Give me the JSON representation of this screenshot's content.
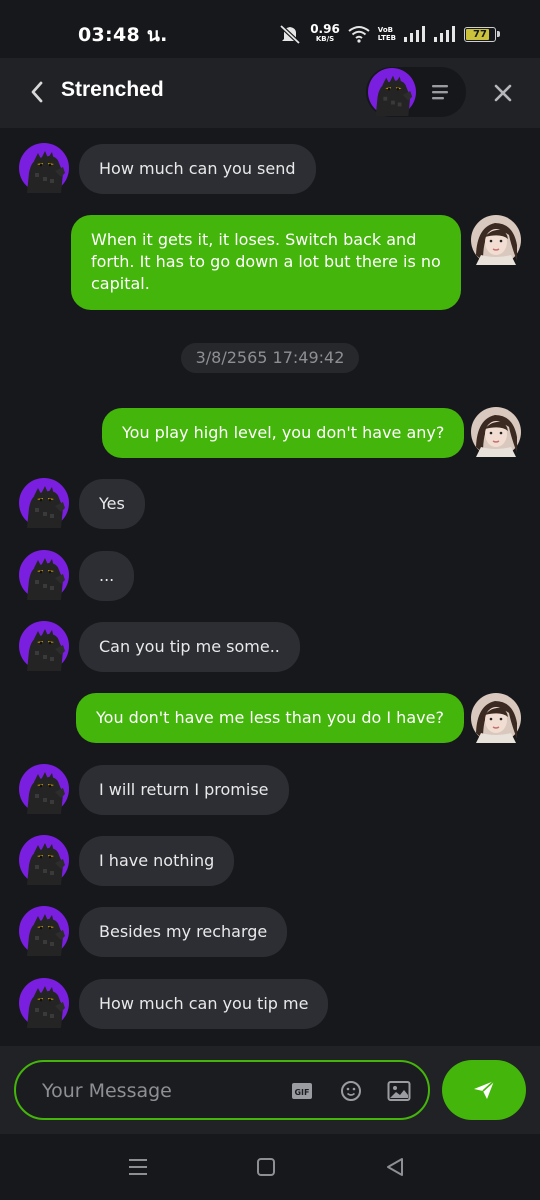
{
  "status_bar": {
    "time": "03:48 น.",
    "net_speed_value": "0.96",
    "net_speed_unit": "KB/S",
    "volte_top": "VoB",
    "volte_bottom": "LTEB",
    "battery": "77"
  },
  "header": {
    "title": "Strenched",
    "icons": [
      "back-arrow-icon",
      "avatar",
      "menu-icon",
      "close-icon"
    ]
  },
  "chat": {
    "timestamp": "3/8/2565 17:49:42",
    "messages": [
      {
        "side": "in",
        "text": "How much can you send"
      },
      {
        "side": "out",
        "text": "When it gets it, it loses. Switch back and forth. It has to go down a lot but there is no capital."
      },
      {
        "side": "out",
        "text": "You play high level, you don't have any?"
      },
      {
        "side": "in",
        "text": "Yes"
      },
      {
        "side": "in",
        "text": "..."
      },
      {
        "side": "in",
        "text": "Can you tip me some.."
      },
      {
        "side": "out",
        "text": "You don't have me less than you do I have?"
      },
      {
        "side": "in",
        "text": "I will return I promise"
      },
      {
        "side": "in",
        "text": "I have nothing"
      },
      {
        "side": "in",
        "text": "Besides my recharge"
      },
      {
        "side": "in",
        "text": "How much can you tip me"
      }
    ]
  },
  "composer": {
    "placeholder": "Your Message",
    "gif_label": "GIF"
  },
  "colors": {
    "accent": "#44b50a",
    "background": "#17181c",
    "incoming_bubble": "#2c2e33",
    "header": "#202226",
    "avatar_purple": "#7a1fe0"
  }
}
